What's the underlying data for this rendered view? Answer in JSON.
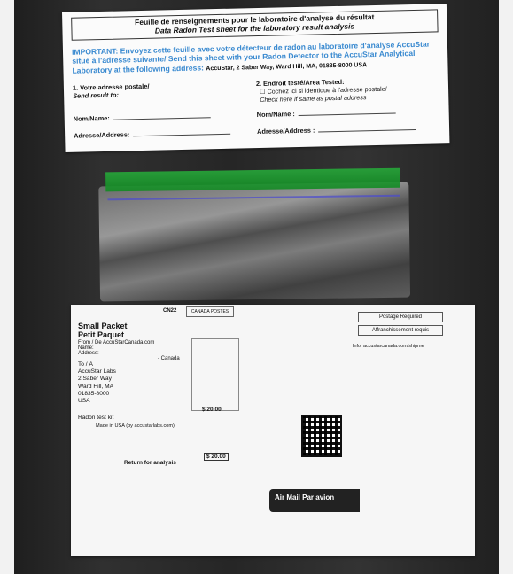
{
  "sheet": {
    "title_fr": "Feuille de renseignements pour le laboratoire d'analyse du résultat",
    "title_en": "Data Radon Test sheet for the laboratory result analysis",
    "important": "IMPORTANT: Envoyez cette feuille avec votre détecteur de radon au laboratoire d'analyse AccuStar situé à l'adresse suivante/ Send this sheet with your Radon Detector to the AccuStar Analytical Laboratory at the following address:",
    "address": "AccuStar, 2 Saber Way, Ward Hill, MA, 01835-8000 USA",
    "col1_title": "1. Votre adresse postale/",
    "col1_sub": "Send result to:",
    "col2_title": "2. Endroit testé/Area Tested:",
    "col2_check": "Cochez ici si identique à l'adresse postale/",
    "col2_check_sub": "Check here if same as postal address",
    "name1": "Nom/Name:",
    "addr1": "Adresse/Address:",
    "name2": "Nom/Name :",
    "addr2": "Adresse/Address :"
  },
  "envelope": {
    "title1": "Small Packet",
    "title2": "Petit Paquet",
    "cn": "CN22",
    "canada_post": "CANADA POSTES",
    "from": "From / De AccuStarCanada.com",
    "name": "Name:",
    "address": "Address:",
    "canada": "- Canada",
    "to": "To / À",
    "to_lines": [
      "AccuStar Labs",
      "2 Saber Way",
      "Ward Hill, MA",
      "01835-8000",
      "USA"
    ],
    "kit": "Radon test kit",
    "made": "Made in USA (by accustarlabs.com)",
    "value": "$ 20.00",
    "return": "Return for analysis",
    "value2": "$ 20.00",
    "postage_req": "Postage Required",
    "affr": "Affranchissement requis",
    "info": "Info: accustarcanada.com/shipme",
    "airmail": "Air Mail  Par avion"
  }
}
